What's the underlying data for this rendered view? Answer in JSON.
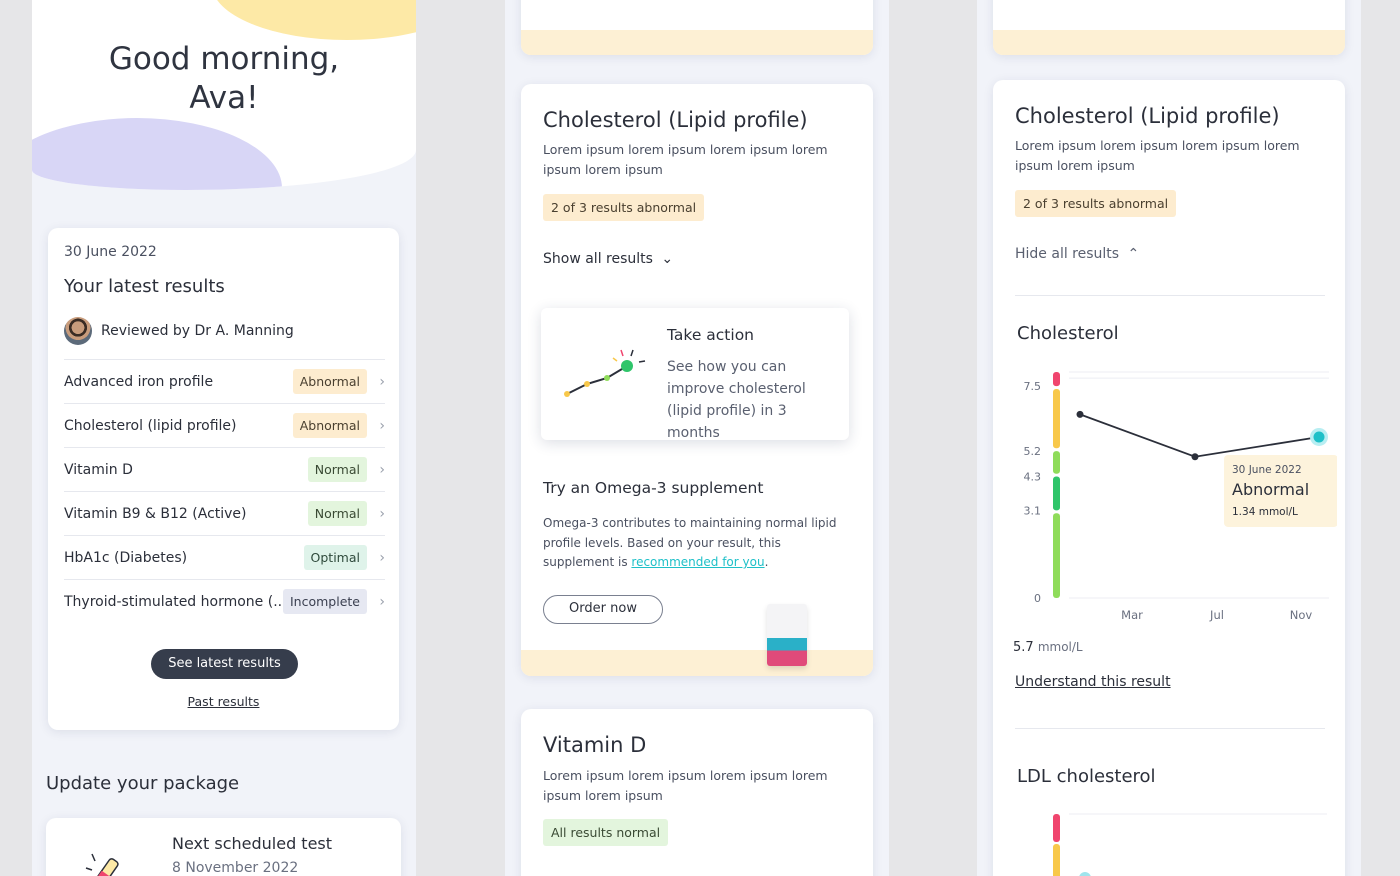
{
  "home": {
    "greeting": "Good morning,",
    "name": "Ava!",
    "latest_card": {
      "date": "30 June 2022",
      "title": "Your latest results",
      "reviewer": "Reviewed by Dr A. Manning",
      "results": [
        {
          "name": "Advanced iron profile",
          "status": "Abnormal"
        },
        {
          "name": "Cholesterol (lipid profile)",
          "status": "Abnormal"
        },
        {
          "name": "Vitamin D",
          "status": "Normal"
        },
        {
          "name": "Vitamin B9 & B12 (Active)",
          "status": "Normal"
        },
        {
          "name": "HbA1c (Diabetes)",
          "status": "Optimal"
        },
        {
          "name": "Thyroid-stimulated hormone (...",
          "status": "Incomplete"
        }
      ],
      "primary_button": "See latest results",
      "secondary_link": "Past results"
    },
    "package_heading": "Update your package",
    "next_test": {
      "title": "Next scheduled test",
      "date": "8 November 2022"
    }
  },
  "detail": {
    "section_title": "Cholesterol (Lipid profile)",
    "description": "Lorem ipsum lorem ipsum lorem ipsum lorem ipsum lorem ipsum",
    "summary_tag": "2 of 3 results abnormal",
    "show_toggle": "Show all results",
    "action_card": {
      "title": "Take action",
      "text": "See how you can improve cholesterol (lipid profile) in 3 months"
    },
    "supplement": {
      "title": "Try an Omega-3 supplement",
      "text_before": "Omega-3 contributes to maintaining normal lipid profile levels. Based on your result, this supplement is ",
      "link": "recommended for you",
      "text_after": ".",
      "button": "Order now"
    },
    "vitamin_d": {
      "title": "Vitamin D",
      "description": "Lorem ipsum lorem ipsum lorem ipsum lorem ipsum lorem ipsum",
      "tag": "All results normal"
    }
  },
  "expanded": {
    "section_title": "Cholesterol (Lipid profile)",
    "description": "Lorem ipsum lorem ipsum lorem ipsum lorem ipsum lorem ipsum",
    "summary_tag": "2 of 3 results abnormal",
    "hide_toggle": "Hide all results",
    "chart_title": "Cholesterol",
    "reading_value": "5.7",
    "reading_unit": "mmol/L",
    "understand_link": "Understand this result",
    "next_chart_title": "LDL cholesterol"
  },
  "chart_data": {
    "type": "line",
    "title": "Cholesterol",
    "x": [
      "Mar",
      "Jul",
      "Nov"
    ],
    "y_ticks": [
      "0",
      "3.1",
      "4.3",
      "5.2",
      "7.5"
    ],
    "series": [
      {
        "values": [
          6.5,
          5.0,
          5.7
        ]
      }
    ],
    "range_colors": {
      "high": "#f0456e",
      "borderline": "#f8c84a",
      "normal": "#8fdc5a",
      "optimal": "#2fc56a"
    },
    "tooltip": {
      "date": "30 June 2022",
      "status": "Abnormal",
      "value": "1.34",
      "unit": "mmol/L"
    }
  },
  "colors": {
    "accent": "#1ec0c8",
    "abnormal_bg": "#fdeccf",
    "normal_bg": "#e3f5dd",
    "dark_button": "#363d4c"
  }
}
